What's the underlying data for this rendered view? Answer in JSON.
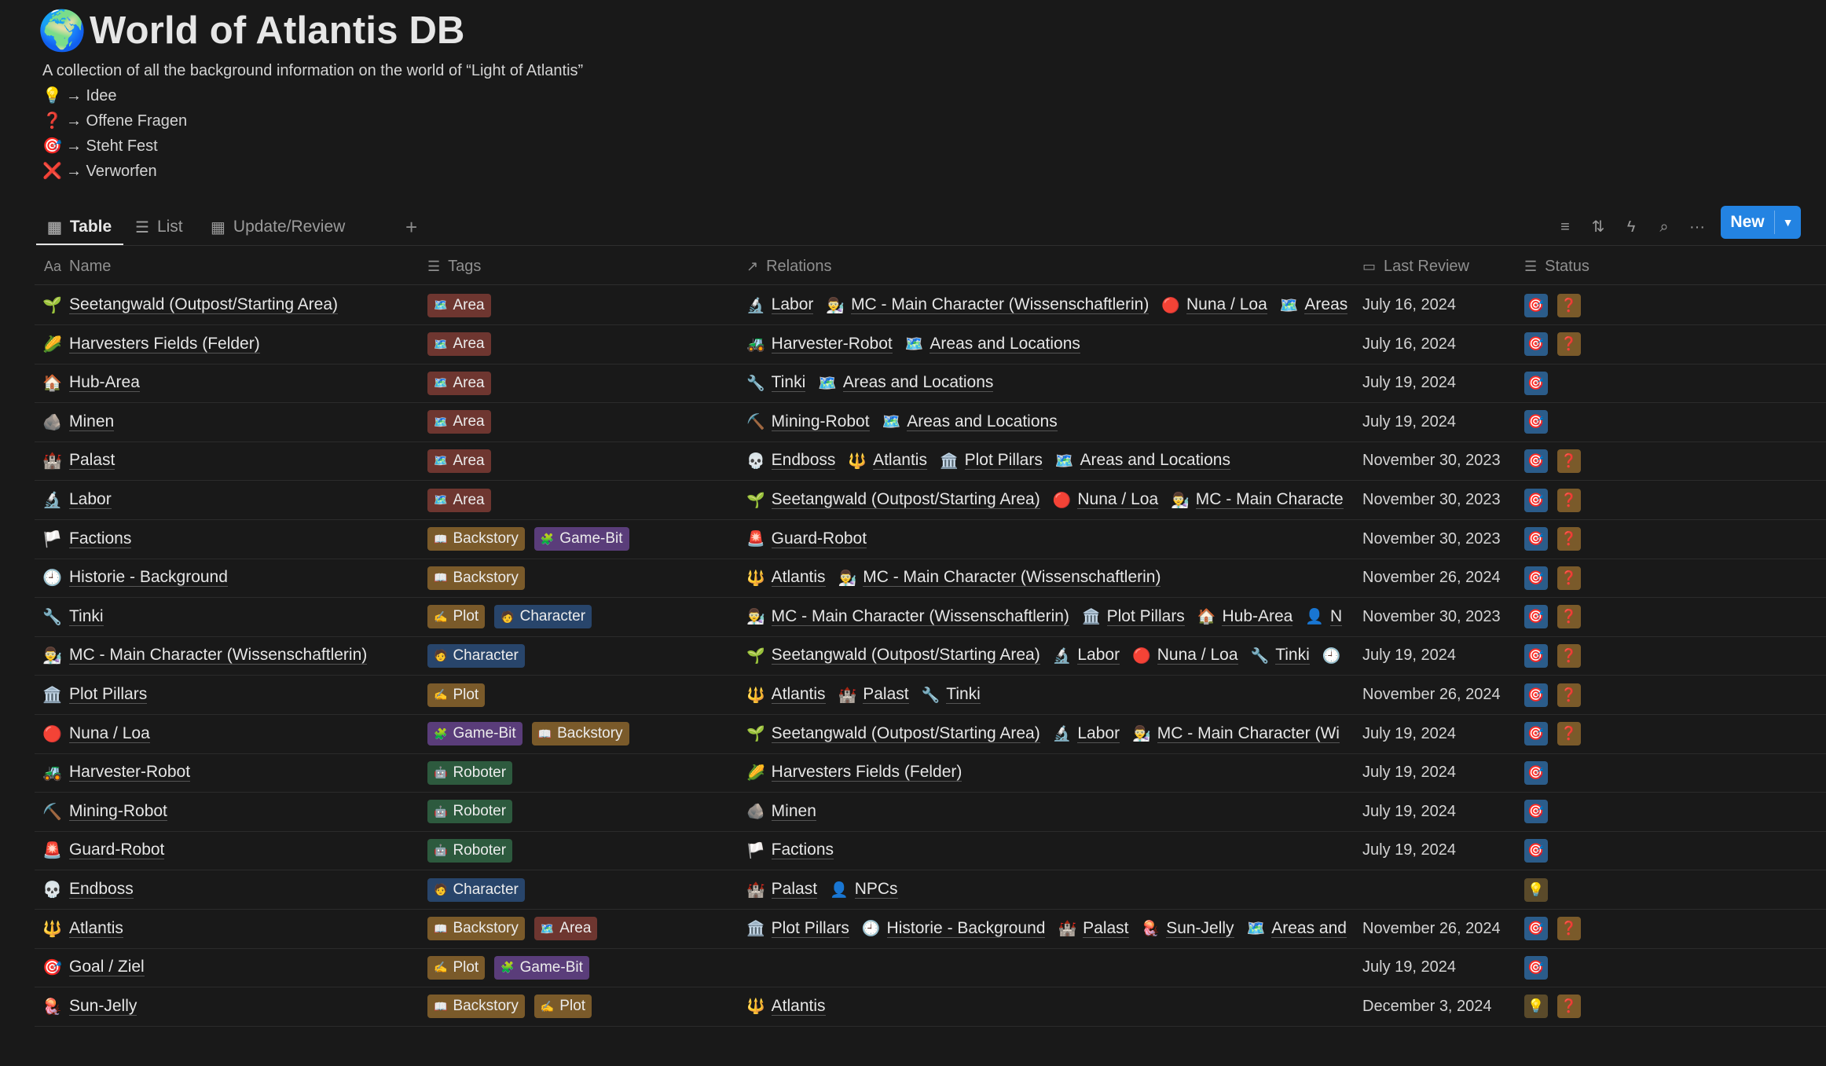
{
  "page": {
    "icon": "🌍",
    "title": "World of Atlantis DB",
    "description": "A collection of all the background information on the world of “Light of Atlantis”",
    "legend": [
      {
        "icon": "💡",
        "text": "→ Idee"
      },
      {
        "icon": "❓",
        "text": "→ Offene Fragen"
      },
      {
        "icon": "🎯",
        "text": "→ Steht Fest"
      },
      {
        "icon": "❌",
        "text": "→ Verworfen"
      }
    ]
  },
  "views": [
    {
      "label": "Table",
      "icon": "table-icon",
      "active": true
    },
    {
      "label": "List",
      "icon": "list-icon",
      "active": false
    },
    {
      "label": "Update/Review",
      "icon": "table-icon",
      "active": false
    }
  ],
  "toolbar": {
    "new_label": "New"
  },
  "columns": {
    "name": "Name",
    "tags": "Tags",
    "relations": "Relations",
    "last_review": "Last Review",
    "status": "Status"
  },
  "rows": [
    {
      "icon": "🌱",
      "name": "Seetangwald (Outpost/Starting Area)",
      "tags": [
        {
          "icon": "🗺️",
          "label": "Area",
          "cls": "t-area"
        }
      ],
      "relations": [
        {
          "icon": "🔬",
          "label": "Labor"
        },
        {
          "icon": "👨‍🔬",
          "label": "MC - Main Character (Wissenschaftlerin)"
        },
        {
          "icon": "🔴",
          "label": "Nuna / Loa"
        },
        {
          "icon": "🗺️",
          "label": "Areas"
        }
      ],
      "date": "July 16, 2024",
      "status": [
        "target",
        "question"
      ]
    },
    {
      "icon": "🌽",
      "name": "Harvesters Fields (Felder)",
      "tags": [
        {
          "icon": "🗺️",
          "label": "Area",
          "cls": "t-area"
        }
      ],
      "relations": [
        {
          "icon": "🚜",
          "label": "Harvester-Robot"
        },
        {
          "icon": "🗺️",
          "label": "Areas and Locations"
        }
      ],
      "date": "July 16, 2024",
      "status": [
        "target",
        "question"
      ]
    },
    {
      "icon": "🏠",
      "name": "Hub-Area",
      "tags": [
        {
          "icon": "🗺️",
          "label": "Area",
          "cls": "t-area"
        }
      ],
      "relations": [
        {
          "icon": "🔧",
          "label": "Tinki"
        },
        {
          "icon": "🗺️",
          "label": "Areas and Locations"
        }
      ],
      "date": "July 19, 2024",
      "status": [
        "target"
      ]
    },
    {
      "icon": "🪨",
      "name": "Minen",
      "tags": [
        {
          "icon": "🗺️",
          "label": "Area",
          "cls": "t-area"
        }
      ],
      "relations": [
        {
          "icon": "⛏️",
          "label": "Mining-Robot"
        },
        {
          "icon": "🗺️",
          "label": "Areas and Locations"
        }
      ],
      "date": "July 19, 2024",
      "status": [
        "target"
      ]
    },
    {
      "icon": "🏰",
      "name": "Palast",
      "tags": [
        {
          "icon": "🗺️",
          "label": "Area",
          "cls": "t-area"
        }
      ],
      "relations": [
        {
          "icon": "💀",
          "label": "Endboss"
        },
        {
          "icon": "🔱",
          "label": "Atlantis"
        },
        {
          "icon": "🏛️",
          "label": "Plot Pillars"
        },
        {
          "icon": "🗺️",
          "label": "Areas and Locations"
        }
      ],
      "date": "November 30, 2023",
      "status": [
        "target",
        "question"
      ]
    },
    {
      "icon": "🔬",
      "name": "Labor",
      "tags": [
        {
          "icon": "🗺️",
          "label": "Area",
          "cls": "t-area"
        }
      ],
      "relations": [
        {
          "icon": "🌱",
          "label": "Seetangwald (Outpost/Starting Area)"
        },
        {
          "icon": "🔴",
          "label": "Nuna / Loa"
        },
        {
          "icon": "👨‍🔬",
          "label": "MC - Main Characte"
        }
      ],
      "date": "November 30, 2023",
      "status": [
        "target",
        "question"
      ]
    },
    {
      "icon": "🏳️",
      "name": "Factions",
      "tags": [
        {
          "icon": "📖",
          "label": "Backstory",
          "cls": "t-backstory"
        },
        {
          "icon": "🧩",
          "label": "Game-Bit",
          "cls": "t-gamebit"
        }
      ],
      "relations": [
        {
          "icon": "🚨",
          "label": "Guard-Robot"
        }
      ],
      "date": "November 30, 2023",
      "status": [
        "target",
        "question"
      ]
    },
    {
      "icon": "🕘",
      "name": "Historie - Background",
      "tags": [
        {
          "icon": "📖",
          "label": "Backstory",
          "cls": "t-backstory"
        }
      ],
      "relations": [
        {
          "icon": "🔱",
          "label": "Atlantis"
        },
        {
          "icon": "👨‍🔬",
          "label": "MC - Main Character (Wissenschaftlerin)"
        }
      ],
      "date": "November 26, 2024",
      "status": [
        "target",
        "question"
      ]
    },
    {
      "icon": "🔧",
      "name": "Tinki",
      "tags": [
        {
          "icon": "✍️",
          "label": "Plot",
          "cls": "t-plot"
        },
        {
          "icon": "🧑",
          "label": "Character",
          "cls": "t-character"
        }
      ],
      "relations": [
        {
          "icon": "👨‍🔬",
          "label": "MC - Main Character (Wissenschaftlerin)"
        },
        {
          "icon": "🏛️",
          "label": "Plot Pillars"
        },
        {
          "icon": "🏠",
          "label": "Hub-Area"
        },
        {
          "icon": "👤",
          "label": "N"
        }
      ],
      "date": "November 30, 2023",
      "status": [
        "target",
        "question"
      ]
    },
    {
      "icon": "👨‍🔬",
      "name": "MC - Main Character (Wissenschaftlerin)",
      "tags": [
        {
          "icon": "🧑",
          "label": "Character",
          "cls": "t-character"
        }
      ],
      "relations": [
        {
          "icon": "🌱",
          "label": "Seetangwald (Outpost/Starting Area)"
        },
        {
          "icon": "🔬",
          "label": "Labor"
        },
        {
          "icon": "🔴",
          "label": "Nuna / Loa"
        },
        {
          "icon": "🔧",
          "label": "Tinki"
        },
        {
          "icon": "🕘",
          "label": ""
        }
      ],
      "date": "July 19, 2024",
      "status": [
        "target",
        "question"
      ]
    },
    {
      "icon": "🏛️",
      "name": "Plot Pillars",
      "tags": [
        {
          "icon": "✍️",
          "label": "Plot",
          "cls": "t-plot"
        }
      ],
      "relations": [
        {
          "icon": "🔱",
          "label": "Atlantis"
        },
        {
          "icon": "🏰",
          "label": "Palast"
        },
        {
          "icon": "🔧",
          "label": "Tinki"
        }
      ],
      "date": "November 26, 2024",
      "status": [
        "target",
        "question"
      ]
    },
    {
      "icon": "🔴",
      "name": "Nuna / Loa",
      "tags": [
        {
          "icon": "🧩",
          "label": "Game-Bit",
          "cls": "t-gamebit"
        },
        {
          "icon": "📖",
          "label": "Backstory",
          "cls": "t-backstory"
        }
      ],
      "relations": [
        {
          "icon": "🌱",
          "label": "Seetangwald (Outpost/Starting Area)"
        },
        {
          "icon": "🔬",
          "label": "Labor"
        },
        {
          "icon": "👨‍🔬",
          "label": "MC - Main Character (Wi"
        }
      ],
      "date": "July 19, 2024",
      "status": [
        "target",
        "question"
      ]
    },
    {
      "icon": "🚜",
      "name": "Harvester-Robot",
      "tags": [
        {
          "icon": "🤖",
          "label": "Roboter",
          "cls": "t-roboter"
        }
      ],
      "relations": [
        {
          "icon": "🌽",
          "label": "Harvesters Fields (Felder)"
        }
      ],
      "date": "July 19, 2024",
      "status": [
        "target"
      ]
    },
    {
      "icon": "⛏️",
      "name": "Mining-Robot",
      "tags": [
        {
          "icon": "🤖",
          "label": "Roboter",
          "cls": "t-roboter"
        }
      ],
      "relations": [
        {
          "icon": "🪨",
          "label": "Minen"
        }
      ],
      "date": "July 19, 2024",
      "status": [
        "target"
      ]
    },
    {
      "icon": "🚨",
      "name": "Guard-Robot",
      "tags": [
        {
          "icon": "🤖",
          "label": "Roboter",
          "cls": "t-roboter"
        }
      ],
      "relations": [
        {
          "icon": "🏳️",
          "label": "Factions"
        }
      ],
      "date": "July 19, 2024",
      "status": [
        "target"
      ]
    },
    {
      "icon": "💀",
      "name": "Endboss",
      "tags": [
        {
          "icon": "🧑",
          "label": "Character",
          "cls": "t-character"
        }
      ],
      "relations": [
        {
          "icon": "🏰",
          "label": "Palast"
        },
        {
          "icon": "👤",
          "label": "NPCs"
        }
      ],
      "date": "",
      "status": [
        "idea"
      ]
    },
    {
      "icon": "🔱",
      "name": "Atlantis",
      "tags": [
        {
          "icon": "📖",
          "label": "Backstory",
          "cls": "t-backstory"
        },
        {
          "icon": "🗺️",
          "label": "Area",
          "cls": "t-area"
        }
      ],
      "relations": [
        {
          "icon": "🏛️",
          "label": "Plot Pillars"
        },
        {
          "icon": "🕘",
          "label": "Historie - Background"
        },
        {
          "icon": "🏰",
          "label": "Palast"
        },
        {
          "icon": "🪼",
          "label": "Sun-Jelly"
        },
        {
          "icon": "🗺️",
          "label": "Areas and"
        }
      ],
      "date": "November 26, 2024",
      "status": [
        "target",
        "question"
      ]
    },
    {
      "icon": "🎯",
      "name": "Goal / Ziel",
      "tags": [
        {
          "icon": "✍️",
          "label": "Plot",
          "cls": "t-plot"
        },
        {
          "icon": "🧩",
          "label": "Game-Bit",
          "cls": "t-gamebit"
        }
      ],
      "relations": [],
      "date": "July 19, 2024",
      "status": [
        "target"
      ]
    },
    {
      "icon": "🪼",
      "name": "Sun-Jelly",
      "tags": [
        {
          "icon": "📖",
          "label": "Backstory",
          "cls": "t-backstory"
        },
        {
          "icon": "✍️",
          "label": "Plot",
          "cls": "t-plot"
        }
      ],
      "relations": [
        {
          "icon": "🔱",
          "label": "Atlantis"
        }
      ],
      "date": "December 3, 2024",
      "status": [
        "idea",
        "question"
      ]
    }
  ],
  "status_icons": {
    "target": "🎯",
    "question": "❓",
    "idea": "💡"
  }
}
